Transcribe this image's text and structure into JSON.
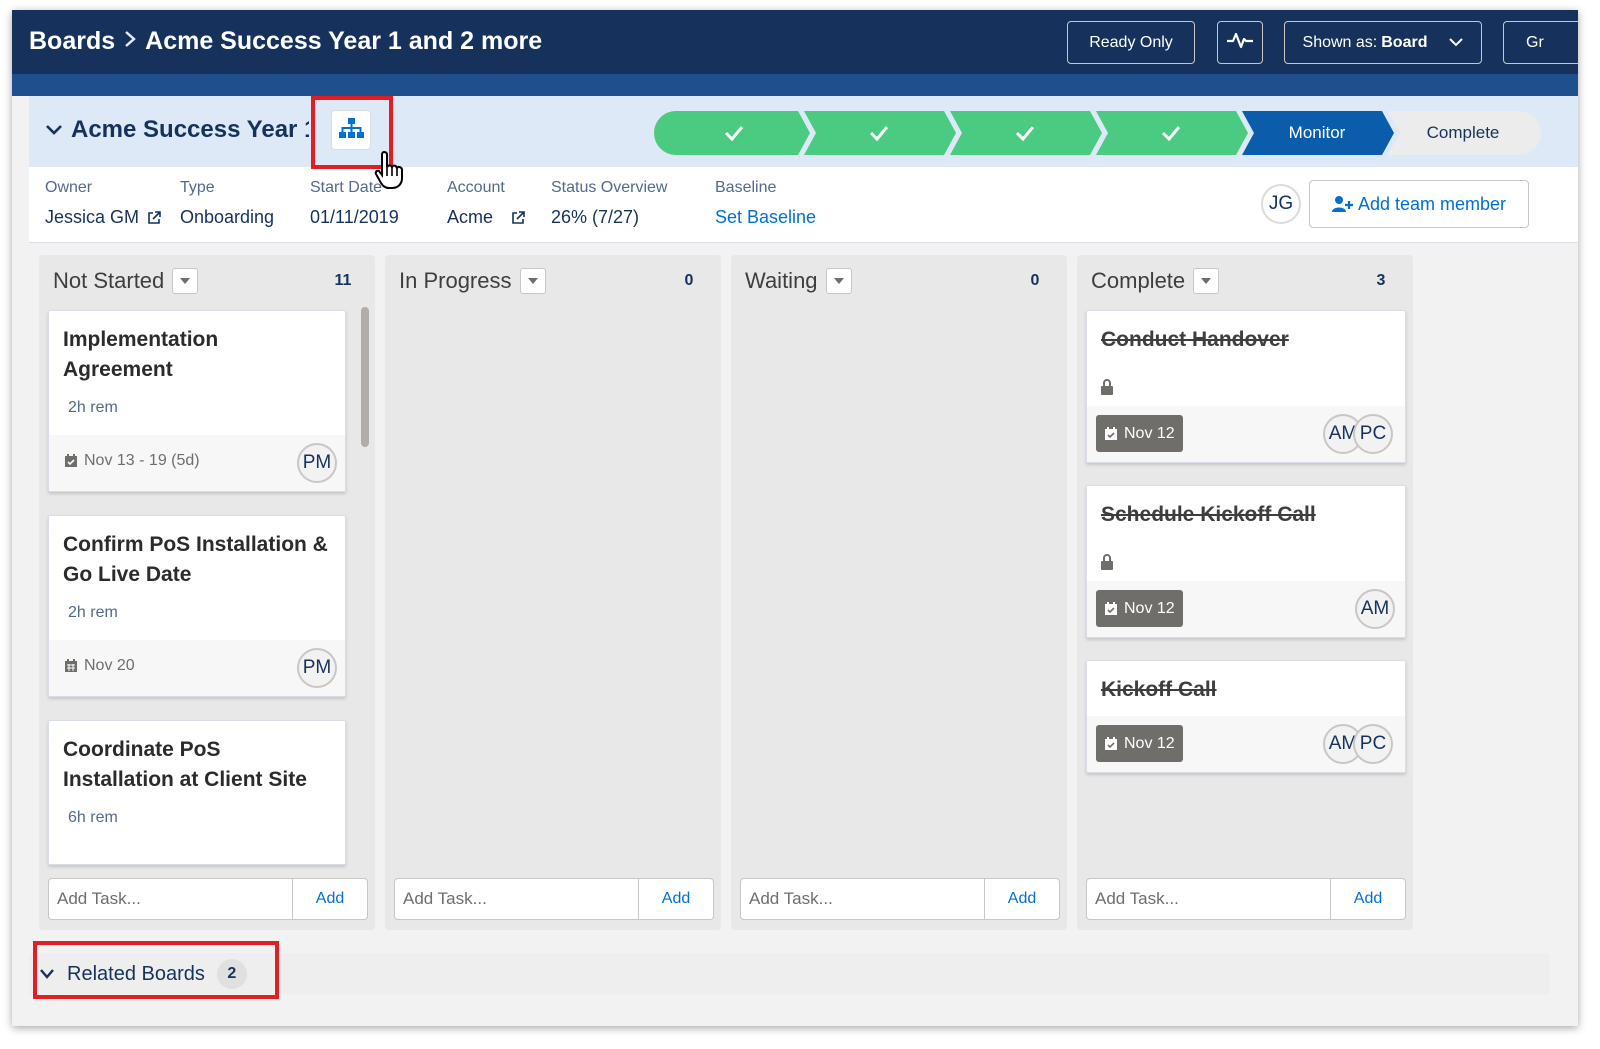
{
  "breadcrumb": {
    "root": "Boards",
    "current": "Acme Success Year 1 and 2 more"
  },
  "header_buttons": {
    "read_only": "Ready Only",
    "shown_as_prefix": "Shown as: ",
    "shown_as_value": "Board",
    "group_partial": "Gr"
  },
  "board": {
    "title": "Acme Success Year 1"
  },
  "path": {
    "stages": [
      {
        "label": "",
        "state": "done"
      },
      {
        "label": "",
        "state": "done"
      },
      {
        "label": "",
        "state": "done"
      },
      {
        "label": "",
        "state": "done"
      },
      {
        "label": "Monitor",
        "state": "current"
      },
      {
        "label": "Complete",
        "state": "todo"
      }
    ],
    "colors": {
      "done": "#4bca81",
      "current": "#0b5cab",
      "todo": "#ececec"
    }
  },
  "details": {
    "owner": {
      "label": "Owner",
      "value": "Jessica GM"
    },
    "type": {
      "label": "Type",
      "value": "Onboarding"
    },
    "start_date": {
      "label": "Start Date",
      "value": "01/11/2019"
    },
    "account": {
      "label": "Account",
      "value": "Acme"
    },
    "status": {
      "label": "Status Overview",
      "value": "26% (7/27)"
    },
    "baseline": {
      "label": "Baseline",
      "value": "Set Baseline"
    },
    "team_avatar": "JG",
    "add_member": "Add team member"
  },
  "columns": [
    {
      "name": "Not Started",
      "count": "11",
      "cards": [
        {
          "title": "Implementation Agreement",
          "rem": "2h rem",
          "date": "Nov 13 - 19 (5d)",
          "avatars": [
            "PM"
          ]
        },
        {
          "title": "Confirm PoS Installation & Go Live Date",
          "rem": "2h rem",
          "date": "Nov 20",
          "avatars": [
            "PM"
          ]
        },
        {
          "title": "Coordinate PoS Installation at Client Site",
          "rem": "6h rem",
          "date": "",
          "avatars": []
        }
      ]
    },
    {
      "name": "In Progress",
      "count": "0",
      "cards": []
    },
    {
      "name": "Waiting",
      "count": "0",
      "cards": []
    },
    {
      "name": "Complete",
      "count": "3",
      "cards": [
        {
          "title": "Conduct Handover",
          "date": "Nov 12",
          "avatars": [
            "AM",
            "PC"
          ]
        },
        {
          "title": "Schedule Kickoff Call",
          "date": "Nov 12",
          "avatars": [
            "AM"
          ]
        },
        {
          "title": "Kickoff Call",
          "date": "Nov 12",
          "avatars": [
            "AM",
            "PC"
          ]
        }
      ]
    }
  ],
  "add_task": {
    "placeholder": "Add Task...",
    "button": "Add"
  },
  "related": {
    "label": "Related Boards",
    "count": "2"
  }
}
